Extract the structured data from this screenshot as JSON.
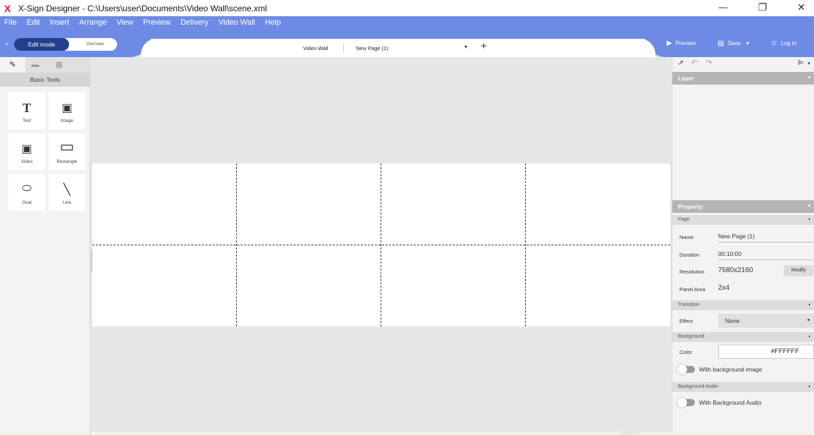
{
  "window": {
    "logo": "X",
    "title": "X-Sign Designer - C:\\Users\\user\\Documents\\Video Wall\\scene.xml",
    "minimize": "—",
    "restore": "❐",
    "close": "✕"
  },
  "menu": [
    "File",
    "Edit",
    "Insert",
    "Arrange",
    "View",
    "Preview",
    "Delivery",
    "Video Wall",
    "Help"
  ],
  "toolbar": {
    "edit_mode": "Edit mode",
    "overview": "Overview",
    "collapse": "«",
    "video_wall": "Video Wall",
    "page_selector": "New Page (1)",
    "page_dropdown": "▾",
    "add_page": "+",
    "preview": "Preview",
    "save": "Save",
    "save_caret": "▾",
    "login": "Log in"
  },
  "left_panel": {
    "tabs": [
      {
        "icon": "pencil-icon",
        "glyph": "✎"
      },
      {
        "icon": "briefcase-icon",
        "glyph": "▬"
      },
      {
        "icon": "layout-icon",
        "glyph": "▦"
      }
    ],
    "section_title": "Basic Tools",
    "tools": [
      {
        "label": "Text",
        "glyph": "T",
        "icon": "text-icon"
      },
      {
        "label": "Image",
        "glyph": "▣",
        "icon": "image-icon"
      },
      {
        "label": "Video",
        "glyph": "▣",
        "icon": "video-icon"
      },
      {
        "label": "Rectangle",
        "glyph": "▭",
        "icon": "rectangle-icon"
      },
      {
        "label": "Oval",
        "glyph": "⬭",
        "icon": "oval-icon"
      },
      {
        "label": "Line",
        "glyph": "╲",
        "icon": "line-icon"
      }
    ]
  },
  "canvas": {
    "resolution": "7680x2160",
    "panel_rows": 2,
    "panel_cols": 4,
    "background": "#FFFFFF"
  },
  "right_panel": {
    "tools": {
      "select": "➚",
      "undo": "↶",
      "redo": "↷",
      "align": "⊫",
      "align_caret": "▾"
    },
    "layer_title": "Layer",
    "property_title": "Property",
    "page_section": "Page",
    "name_label": "Name",
    "name_value": "New Page (1)",
    "duration_label": "Duration",
    "duration_value": "00:10:00",
    "resolution_label": "Resolution",
    "resolution_value": "7680x2160",
    "modify_button": "Modify",
    "panel_area_label": "Panel Area",
    "panel_area_value": "2x4",
    "transition_section": "Transition",
    "effect_label": "Effect",
    "effect_value": "None",
    "background_section": "Background",
    "color_label": "Color",
    "color_value": "#FFFFFF",
    "with_bg_image": "With background image",
    "bg_audio_section": "Background Audio",
    "with_bg_audio": "With Background Audio",
    "chevron": "▾"
  },
  "colors": {
    "accent": "#6d8be4",
    "edit_mode_bg": "#23408f"
  }
}
